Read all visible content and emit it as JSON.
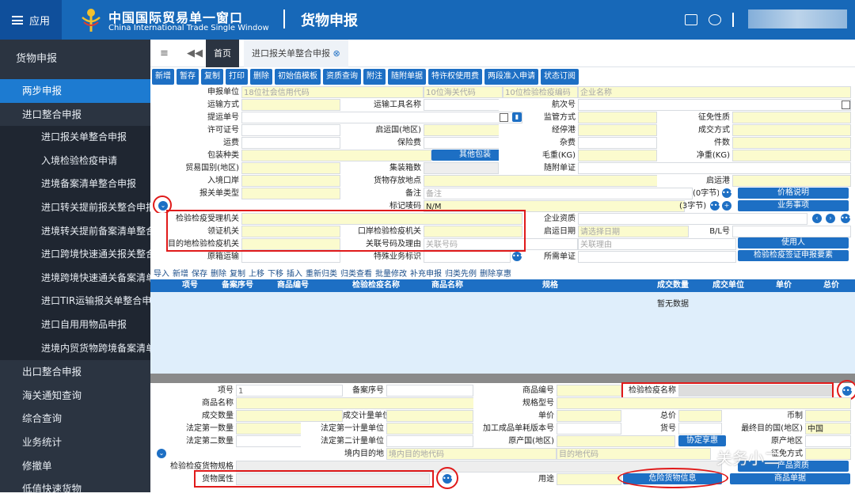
{
  "header": {
    "menu_label": "应用",
    "brand_cn": "中国国际贸易单一窗口",
    "brand_en": "China International Trade Single Window",
    "module": "货物申报"
  },
  "sidebar": {
    "title": "货物申报",
    "items": [
      {
        "label": "两步申报",
        "level": 1,
        "active": true
      },
      {
        "label": "进口整合申报",
        "level": 1
      },
      {
        "label": "进口报关单整合申报",
        "level": 2
      },
      {
        "label": "入境检验检疫申请",
        "level": 2
      },
      {
        "label": "进境备案清单整合申报",
        "level": 2
      },
      {
        "label": "进口转关提前报关整合申报",
        "level": 2
      },
      {
        "label": "进境转关提前备案清单整合申报",
        "level": 2
      },
      {
        "label": "进口跨境快速通关报关整合申报",
        "level": 2
      },
      {
        "label": "进境跨境快速通关备案清单整合申报",
        "level": 2
      },
      {
        "label": "进口TIR运输报关单整合申报",
        "level": 2
      },
      {
        "label": "进口自用用物品申报",
        "level": 2
      },
      {
        "label": "进境内贸货物跨境备案清单",
        "level": 2
      },
      {
        "label": "出口整合申报",
        "level": 1
      },
      {
        "label": "海关通知查询",
        "level": 1
      },
      {
        "label": "综合查询",
        "level": 1
      },
      {
        "label": "业务统计",
        "level": 1
      },
      {
        "label": "修撤单",
        "level": 1
      },
      {
        "label": "低值快速货物",
        "level": 1
      }
    ]
  },
  "tabs": {
    "home": "首页",
    "current": "进口报关单整合申报"
  },
  "toolbar": [
    "新增",
    "暂存",
    "复制",
    "打印",
    "删除",
    "初始值模板",
    "资质查询",
    "附注",
    "随附单据",
    "特许权使用费",
    "两段准入申请",
    "状态订阅"
  ],
  "form": {
    "l_sbdw": "申报单位",
    "ph_credit": "18位社会信用代码",
    "ph_customs": "10位海关代码",
    "ph_ciq": "10位检验检疫编码",
    "ph_ent": "企业名称",
    "l_ysfs": "运输方式",
    "l_ysgj": "运输工具名称",
    "l_hch": "航次号",
    "l_tydh": "提运单号",
    "l_jgfs": "监管方式",
    "l_zmxz": "征免性质",
    "l_xkzh": "许可证号",
    "l_qyg": "启运国(地区)",
    "l_jtg": "经停港",
    "l_cjfs": "成交方式",
    "l_yf": "运费",
    "l_bxf": "保险费",
    "l_zf": "杂费",
    "l_js": "件数",
    "l_bzzl": "包装种类",
    "b_qtbz": "其他包装",
    "l_mz": "毛重(KG)",
    "l_jz": "净重(KG)",
    "l_mygb": "贸易国别(地区)",
    "l_jzxs": "集装箱数",
    "l_sfdz": "随附单证",
    "l_rjka": "入境口岸",
    "l_hwcf": "货物存放地点",
    "l_qyg2": "启运港",
    "l_bgdlx": "报关单类型",
    "l_bz": "备注",
    "v_bz": "备注",
    "v_bz_cnt": "(0字节)",
    "b_jgsm": "价格说明",
    "l_bjmt": "标记唛码",
    "v_bjmt": "N/M",
    "v_bjmt_cnt": "(3字节)",
    "b_ywsx": "业务事项",
    "l_jyjy": "检验检疫受理机关",
    "l_qyzz": "企业资质",
    "l_lzjg": "领证机关",
    "l_kajg": "口岸检验检疫机关",
    "l_qyrq": "启运日期",
    "ph_date": "请选择日期",
    "l_bl": "B/L号",
    "l_mdd": "目的地检验检疫机关",
    "l_glhm": "关联号码及理由",
    "ph_glhm": "关联号码",
    "ph_glly": "关联理由",
    "b_syr": "使用人",
    "l_yxys": "原箱运输",
    "l_tsyw": "特殊业务标识",
    "l_sxdz": "所需单证",
    "b_qzsq": "检验检疫签证申报要素"
  },
  "grid": {
    "actions": [
      "导入",
      "新增",
      "保存",
      "删除",
      "复制",
      "上移",
      "下移",
      "插入",
      "重新归类",
      "归类查看",
      "批量修改",
      "补充申报",
      "归类先例",
      "删除享惠"
    ],
    "columns": [
      "项号",
      "备案序号",
      "商品编号",
      "检验检疫名称",
      "商品名称",
      "规格",
      "成交数量",
      "成交单位",
      "单价",
      "总价"
    ],
    "empty": "暂无数据"
  },
  "detail": {
    "l_xh": "项号",
    "v_xh": "1",
    "l_baxh": "备案序号",
    "l_spbh": "商品编号",
    "l_jyjymc": "检验检疫名称",
    "l_spmc": "商品名称",
    "l_ggxh": "规格型号",
    "l_cjsl": "成交数量",
    "l_cjjldw": "成交计量单位",
    "l_dj": "单价",
    "l_zj": "总价",
    "l_bz": "币制",
    "l_fddy": "法定第一数量",
    "l_fddydw": "法定第一计量单位",
    "l_jgcp": "加工成品单耗版本号",
    "l_hh": "货号",
    "l_zzmdg": "最终目的国(地区)",
    "v_zzmdg": "中国",
    "l_fdde": "法定第二数量",
    "l_fddedw": "法定第二计量单位",
    "l_ycd": "原产国(地区)",
    "b_xdxh": "协定享惠",
    "l_ycdq": "原产地区",
    "l_jnmdd": "境内目的地",
    "ph_jnmdd": "境内目的地代码",
    "ph_mdd": "目的地代码",
    "l_fs": "征免方式",
    "l_hwgg": "检验检疫货物规格",
    "b_cpzz": "产品资质",
    "l_hwsx": "货物属性",
    "l_yt": "用途",
    "b_wxhw": "危险货物信息",
    "b_cpxk": "商品单据"
  },
  "watermark": "关务小二"
}
